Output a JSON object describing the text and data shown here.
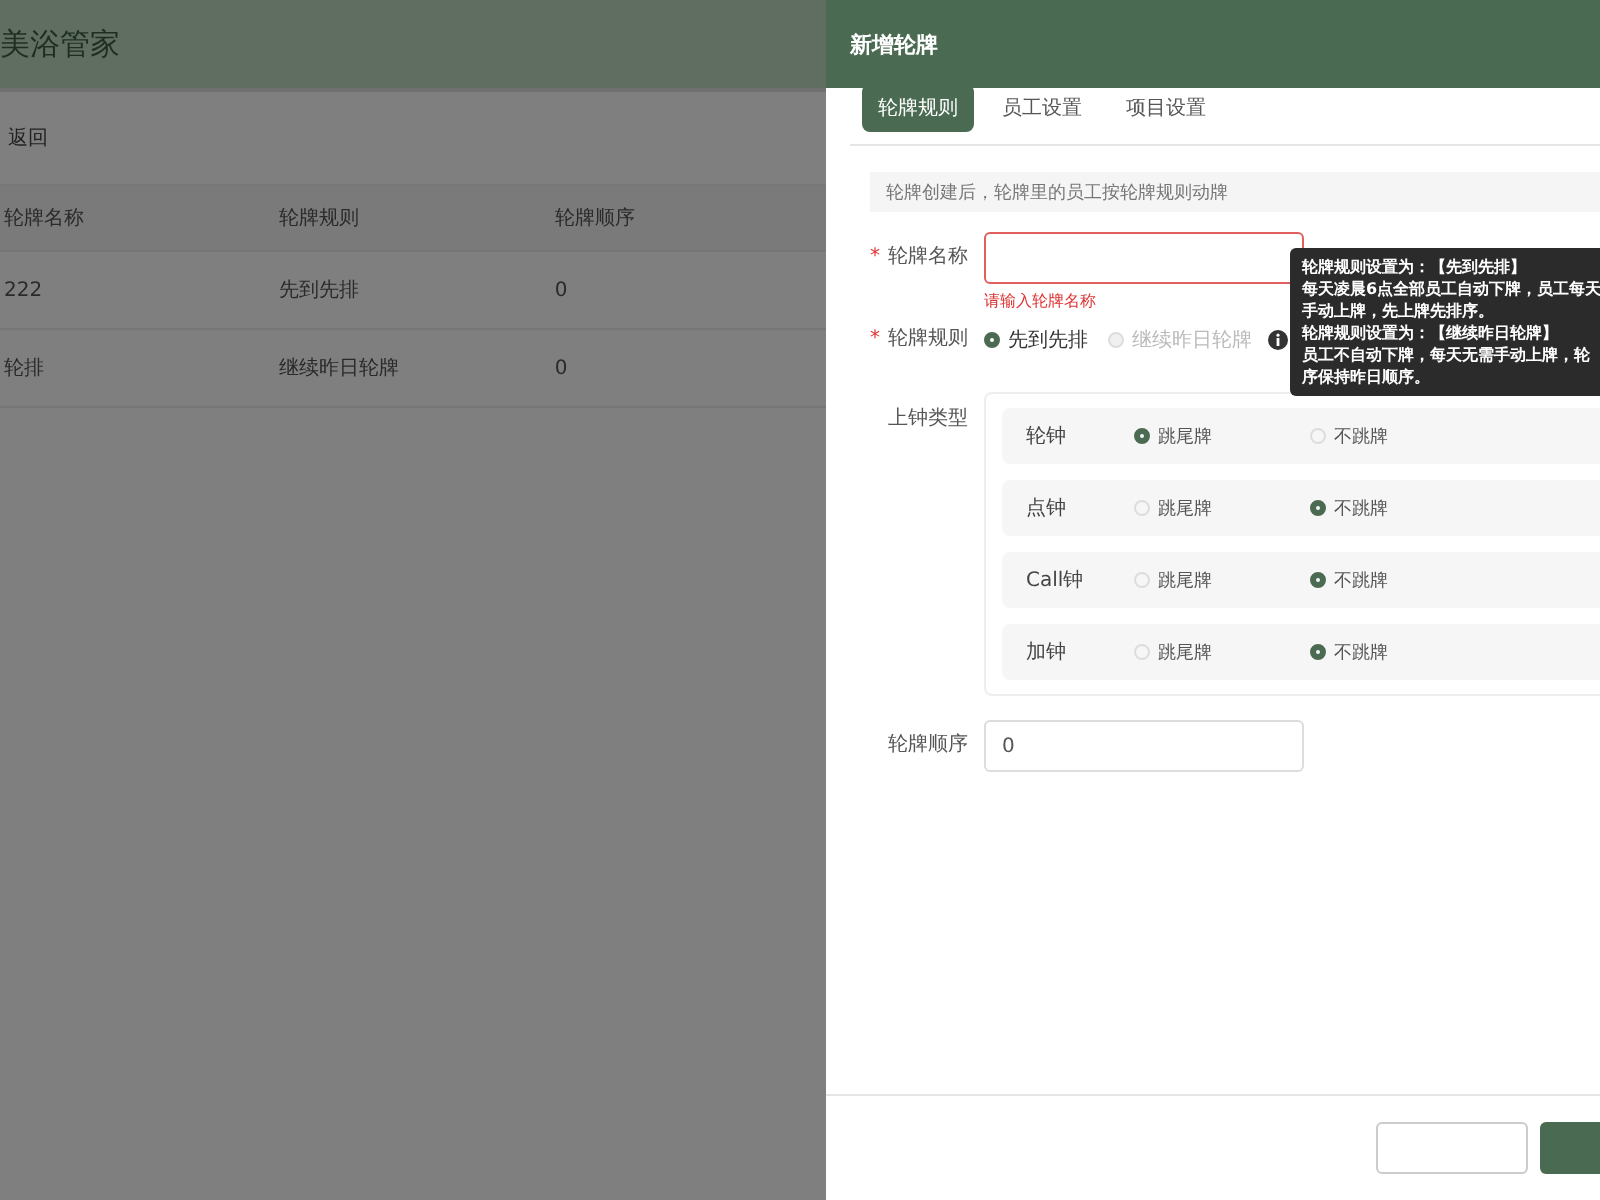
{
  "app": {
    "title": "美浴管家"
  },
  "back_link": "返回",
  "table": {
    "columns": [
      "轮牌名称",
      "轮牌规则",
      "轮牌顺序"
    ],
    "rows": [
      {
        "cells": [
          "222",
          "先到先排",
          "0"
        ]
      },
      {
        "cells": [
          "轮排",
          "继续昨日轮牌",
          "0"
        ]
      }
    ]
  },
  "drawer": {
    "title": "新增轮牌",
    "tabs": [
      {
        "label": "轮牌规则",
        "selected": true
      },
      {
        "label": "员工设置",
        "selected": false
      },
      {
        "label": "项目设置",
        "selected": false
      }
    ],
    "notice": "轮牌创建后，轮牌里的员工按轮牌规则动牌",
    "name_field": {
      "label": "轮牌名称",
      "required_mark": "*",
      "error": "请输入轮牌名称"
    },
    "rule": {
      "label": "轮牌规则",
      "required_mark": "*",
      "options": [
        {
          "label": "先到先排",
          "selected": true,
          "disabled": false
        },
        {
          "label": "继续昨日轮牌",
          "selected": false,
          "disabled": true
        }
      ],
      "tooltip": [
        "轮牌规则设置为：【先到先排】",
        "每天凌晨6点全部员工自动下牌，员工每天",
        "手动上牌，先上牌先排序。",
        "轮牌规则设置为：【继续昨日轮牌】",
        "员工不自动下牌，每天无需手动上牌，轮",
        "序保持昨日顺序。"
      ]
    },
    "clock_types": {
      "label": "上钟类型",
      "rows": [
        {
          "name": "轮钟",
          "options": [
            {
              "label": "跳尾牌",
              "selected": true
            },
            {
              "label": "不跳牌",
              "selected": false
            }
          ]
        },
        {
          "name": "点钟",
          "options": [
            {
              "label": "跳尾牌",
              "selected": false
            },
            {
              "label": "不跳牌",
              "selected": true
            }
          ]
        },
        {
          "name": "Call钟",
          "options": [
            {
              "label": "跳尾牌",
              "selected": false
            },
            {
              "label": "不跳牌",
              "selected": true
            }
          ]
        },
        {
          "name": "加钟",
          "options": [
            {
              "label": "跳尾牌",
              "selected": false
            },
            {
              "label": "不跳牌",
              "selected": true
            }
          ]
        }
      ]
    },
    "order_field": {
      "label": "轮牌顺序",
      "value": "0"
    },
    "footer_buttons": [
      {
        "kind": "secondary"
      },
      {
        "kind": "primary"
      }
    ]
  }
}
